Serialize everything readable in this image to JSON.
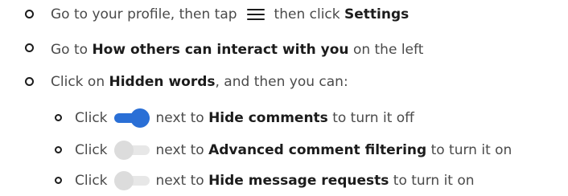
{
  "steps": [
    {
      "pre": "Go to your profile, then tap",
      "mid": "then click",
      "bold": "Settings",
      "icon": "menu-icon"
    },
    {
      "pre": "Go to",
      "bold": "How others can interact with you",
      "post": "on the left"
    },
    {
      "pre": "Click on",
      "bold": "Hidden words",
      "post": ", and then you can:"
    }
  ],
  "substeps": [
    {
      "pre": "Click",
      "toggle_state": "on",
      "mid": "next to",
      "bold": "Hide comments",
      "post": "to turn it off"
    },
    {
      "pre": "Click",
      "toggle_state": "off",
      "mid": "next to",
      "bold": "Advanced comment filtering",
      "post": "to turn it on"
    },
    {
      "pre": "Click",
      "toggle_state": "off",
      "mid": "next to",
      "bold": "Hide message requests",
      "post": "to turn it on"
    }
  ],
  "colors": {
    "toggle_on": "#2a6fd6",
    "toggle_off": "#dcdcdc",
    "text": "#4a4a4a",
    "bold_text": "#1c1c1c"
  }
}
